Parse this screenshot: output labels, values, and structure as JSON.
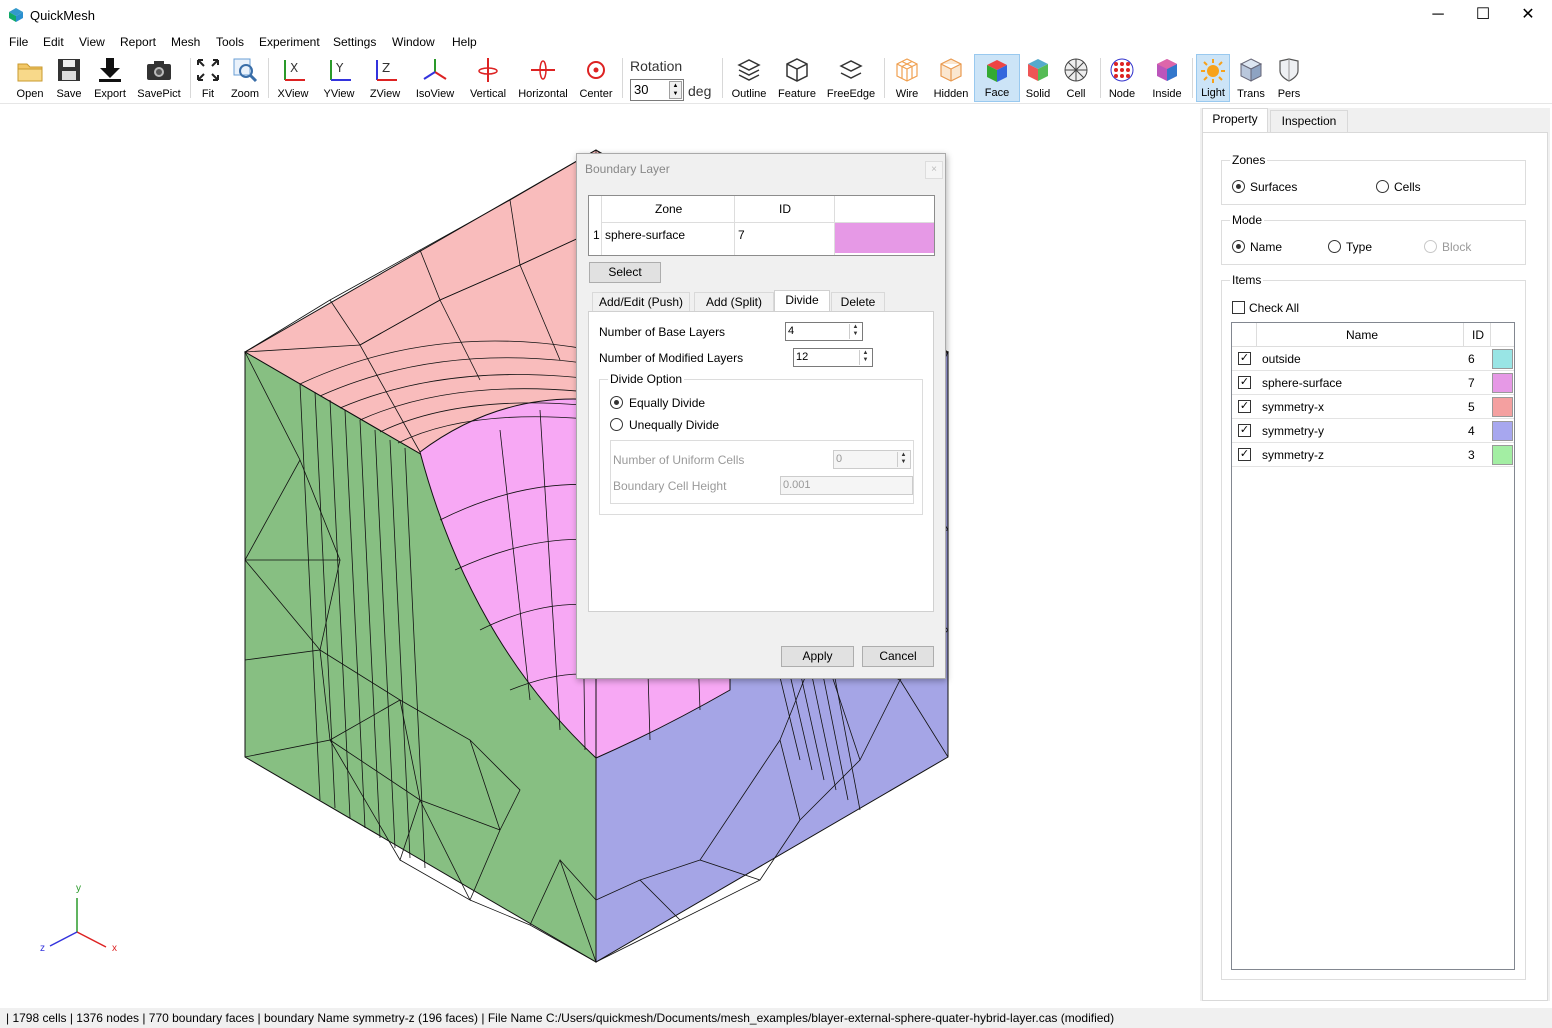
{
  "window": {
    "title": "QuickMesh",
    "minimize": "─",
    "maximize": "☐",
    "close": "✕"
  },
  "menu": [
    "File",
    "Edit",
    "View",
    "Report",
    "Mesh",
    "Tools",
    "Experiment",
    "Settings",
    "Window",
    "Help"
  ],
  "toolbar": {
    "buttons": [
      "Open",
      "Save",
      "Export",
      "SavePict",
      "Fit",
      "Zoom",
      "XView",
      "YView",
      "ZView",
      "IsoView",
      "Vertical",
      "Horizontal",
      "Center"
    ],
    "rotation_label": "Rotation",
    "rotation_value": "30",
    "rotation_unit": "deg",
    "buttons2": [
      "Outline",
      "Feature",
      "FreeEdge",
      "Wire",
      "Hidden",
      "Face",
      "Solid",
      "Cell",
      "Node",
      "Inside",
      "Light",
      "Trans",
      "Pers"
    ]
  },
  "axes": {
    "x": "x",
    "y": "y",
    "z": "z"
  },
  "dialog": {
    "title": "Boundary Layer",
    "close": "×",
    "table": {
      "headers": [
        "Zone",
        "ID"
      ],
      "row_num": "1",
      "zone": "sphere-surface",
      "id": "7",
      "color": "#e699e6"
    },
    "select_label": "Select",
    "tabs": [
      "Add/Edit (Push)",
      "Add (Split)",
      "Divide",
      "Delete"
    ],
    "base_layers_label": "Number of Base Layers",
    "base_layers_value": "4",
    "modified_layers_label": "Number of Modified Layers",
    "modified_layers_value": "12",
    "divide_option_label": "Divide Option",
    "equally_divide": "Equally Divide",
    "unequally_divide": "Unequally Divide",
    "uniform_cells_label": "Number of Uniform Cells",
    "uniform_cells_value": "0",
    "cell_height_label": "Boundary Cell Height",
    "cell_height_value": "0.001",
    "apply_label": "Apply",
    "cancel_label": "Cancel"
  },
  "panel": {
    "tabs": [
      "Property",
      "Inspection"
    ],
    "zones_label": "Zones",
    "surfaces": "Surfaces",
    "cells": "Cells",
    "mode_label": "Mode",
    "name": "Name",
    "type": "Type",
    "block": "Block",
    "items_label": "Items",
    "check_all": "Check All",
    "col_name": "Name",
    "col_id": "ID",
    "items": [
      {
        "name": "outside",
        "id": "6",
        "color": "#99e5e5"
      },
      {
        "name": "sphere-surface",
        "id": "7",
        "color": "#e699e6"
      },
      {
        "name": "symmetry-x",
        "id": "5",
        "color": "#f4a0a0"
      },
      {
        "name": "symmetry-y",
        "id": "4",
        "color": "#a7a7ef"
      },
      {
        "name": "symmetry-z",
        "id": "3",
        "color": "#a3eea3"
      }
    ]
  },
  "status": "| 1798 cells | 1376 nodes | 770 boundary faces |  boundary Name symmetry-z (196 faces) | File Name C:/Users/quickmesh/Documents/mesh_examples/blayer-external-sphere-quater-hybrid-layer.cas (modified)"
}
